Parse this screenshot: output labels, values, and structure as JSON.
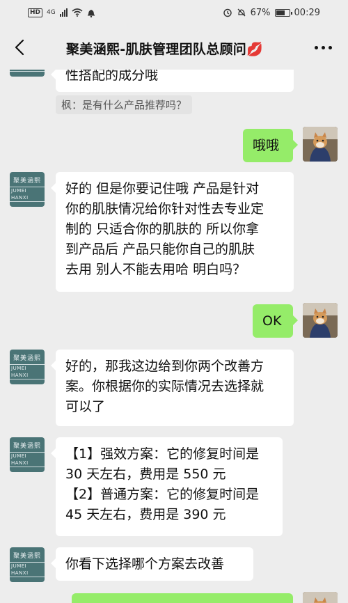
{
  "status_bar": {
    "hd": "HD",
    "network": "4G",
    "battery_percent": "67%",
    "time": "00:29"
  },
  "header": {
    "title": "聚美涵熙-肌肤管理团队总顾问💋"
  },
  "avatars": {
    "brand_line1": "聚美涵熙",
    "brand_line2": "JUMEI HANXI"
  },
  "messages": {
    "m0": {
      "lines": [
        "性搭配的成分哦"
      ]
    },
    "quote": "枫：是有什么产品推荐吗？",
    "m1": {
      "lines": [
        "哦哦"
      ]
    },
    "m2": {
      "lines": [
        "好的  但是你要记住哦  产品是针对",
        "你的肌肤情况给你针对性去专业定",
        "制的  只适合你的肌肤的  所以你拿",
        "到产品后  产品只能你自己的肌肤",
        "去用  别人不能去用哈  明白吗？"
      ]
    },
    "m3": {
      "lines": [
        "OK"
      ]
    },
    "m4": {
      "lines": [
        "好的，那我这边给到你两个改善方",
        "案。你根据你的实际情况去选择就",
        "可以了"
      ]
    },
    "m5": {
      "lines": [
        "【1】强效方案：它的修复时间是",
        "30 天左右，费用是 550 元",
        "【2】普通方案：它的修复时间是",
        "45 天左右，费用是 390 元"
      ]
    },
    "m6": {
      "lines": [
        "你看下选择哪个方案去改善"
      ]
    }
  },
  "colors": {
    "background": "#ededed",
    "bubble_left": "#ffffff",
    "bubble_right": "#95ec69",
    "brand_avatar": "#4a7476"
  },
  "icons": {
    "back": "chevron-left-icon",
    "more": "more-dots-icon",
    "wifi": "wifi-icon",
    "bell": "bell-icon",
    "alarm": "alarm-icon",
    "mute": "mute-icon",
    "battery": "battery-icon"
  }
}
